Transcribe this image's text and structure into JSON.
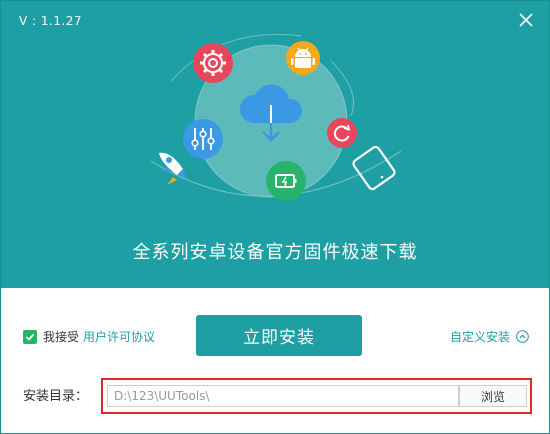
{
  "window": {
    "version": "V : 1.1.27",
    "headline": "全系列安卓设备官方固件极速下载"
  },
  "footer": {
    "agree_text": "我接受",
    "license_link": "用户许可协议",
    "install_label": "立即安装",
    "custom_install_label": "自定义安装",
    "agreed": true
  },
  "install_dir": {
    "label": "安装目录：",
    "value": "D:\\123\\UUTools\\",
    "browse_label": "浏览"
  },
  "icons": [
    "close-icon",
    "gear-icon",
    "android-icon",
    "cloud-download-icon",
    "refresh-icon",
    "sliders-icon",
    "rocket-icon",
    "battery-icon",
    "tablet-icon",
    "checkmark-icon",
    "chevron-up-icon"
  ],
  "colors": {
    "primary": "#1e9fa3",
    "checkbox": "#27b36a",
    "highlight_frame": "#e02a2a",
    "gear_bubble": "#e8465b",
    "android_bubble": "#f4a81e",
    "refresh_bubble": "#e8465b",
    "sliders_bubble": "#3a98e4",
    "battery_bubble": "#27b36a"
  }
}
